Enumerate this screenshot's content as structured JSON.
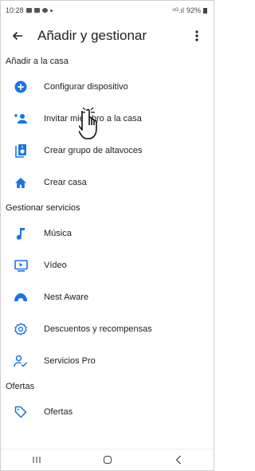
{
  "status_bar": {
    "time": "10:28",
    "signal": "⁴ᴳ.ıl",
    "battery": "92%"
  },
  "app_bar": {
    "title": "Añadir y gestionar",
    "back_icon": "arrow-left-icon",
    "menu_icon": "more-vert-icon"
  },
  "sections": {
    "add": {
      "header": "Añadir a la casa",
      "items": [
        {
          "label": "Configurar dispositivo",
          "icon": "add-circle-icon"
        },
        {
          "label": "Invitar miembro a la casa",
          "icon": "person-add-icon"
        },
        {
          "label": "Crear grupo de altavoces",
          "icon": "speaker-group-icon"
        },
        {
          "label": "Crear casa",
          "icon": "home-icon"
        }
      ]
    },
    "manage": {
      "header": "Gestionar servicios",
      "items": [
        {
          "label": "Música",
          "icon": "music-note-icon"
        },
        {
          "label": "Vídeo",
          "icon": "video-icon"
        },
        {
          "label": "Nest Aware",
          "icon": "nest-aware-icon"
        },
        {
          "label": "Descuentos y recompensas",
          "icon": "discount-badge-icon"
        },
        {
          "label": "Servicios Pro",
          "icon": "person-check-icon"
        }
      ]
    },
    "offers": {
      "header": "Ofertas",
      "items": [
        {
          "label": "Ofertas",
          "icon": "tag-icon"
        }
      ]
    }
  },
  "colors": {
    "accent": "#1a73e8",
    "text": "#202124"
  }
}
